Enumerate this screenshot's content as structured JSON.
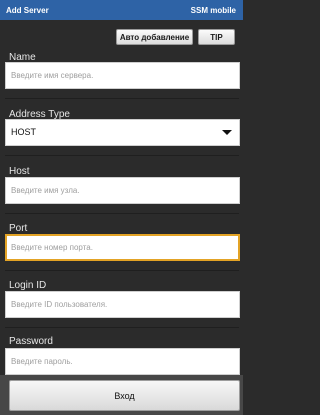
{
  "header": {
    "title": "Add Server",
    "app_name": "SSM mobile"
  },
  "toolbar": {
    "auto_add_label": "Авто добавление",
    "tip_label": "TIP"
  },
  "form": {
    "name": {
      "label": "Name",
      "placeholder": "Введите имя сервера."
    },
    "address_type": {
      "label": "Address Type",
      "value": "HOST"
    },
    "host": {
      "label": "Host",
      "placeholder": "Введите имя узла."
    },
    "port": {
      "label": "Port",
      "placeholder": "Введите номер порта."
    },
    "login_id": {
      "label": "Login ID",
      "placeholder": "Введите ID пользователя."
    },
    "password": {
      "label": "Password",
      "placeholder": "Введите пароль."
    }
  },
  "footer": {
    "login_label": "Вход"
  },
  "colors": {
    "titlebar": "#2e63a6",
    "background": "#2b2b2b",
    "focus": "#e3a325"
  }
}
